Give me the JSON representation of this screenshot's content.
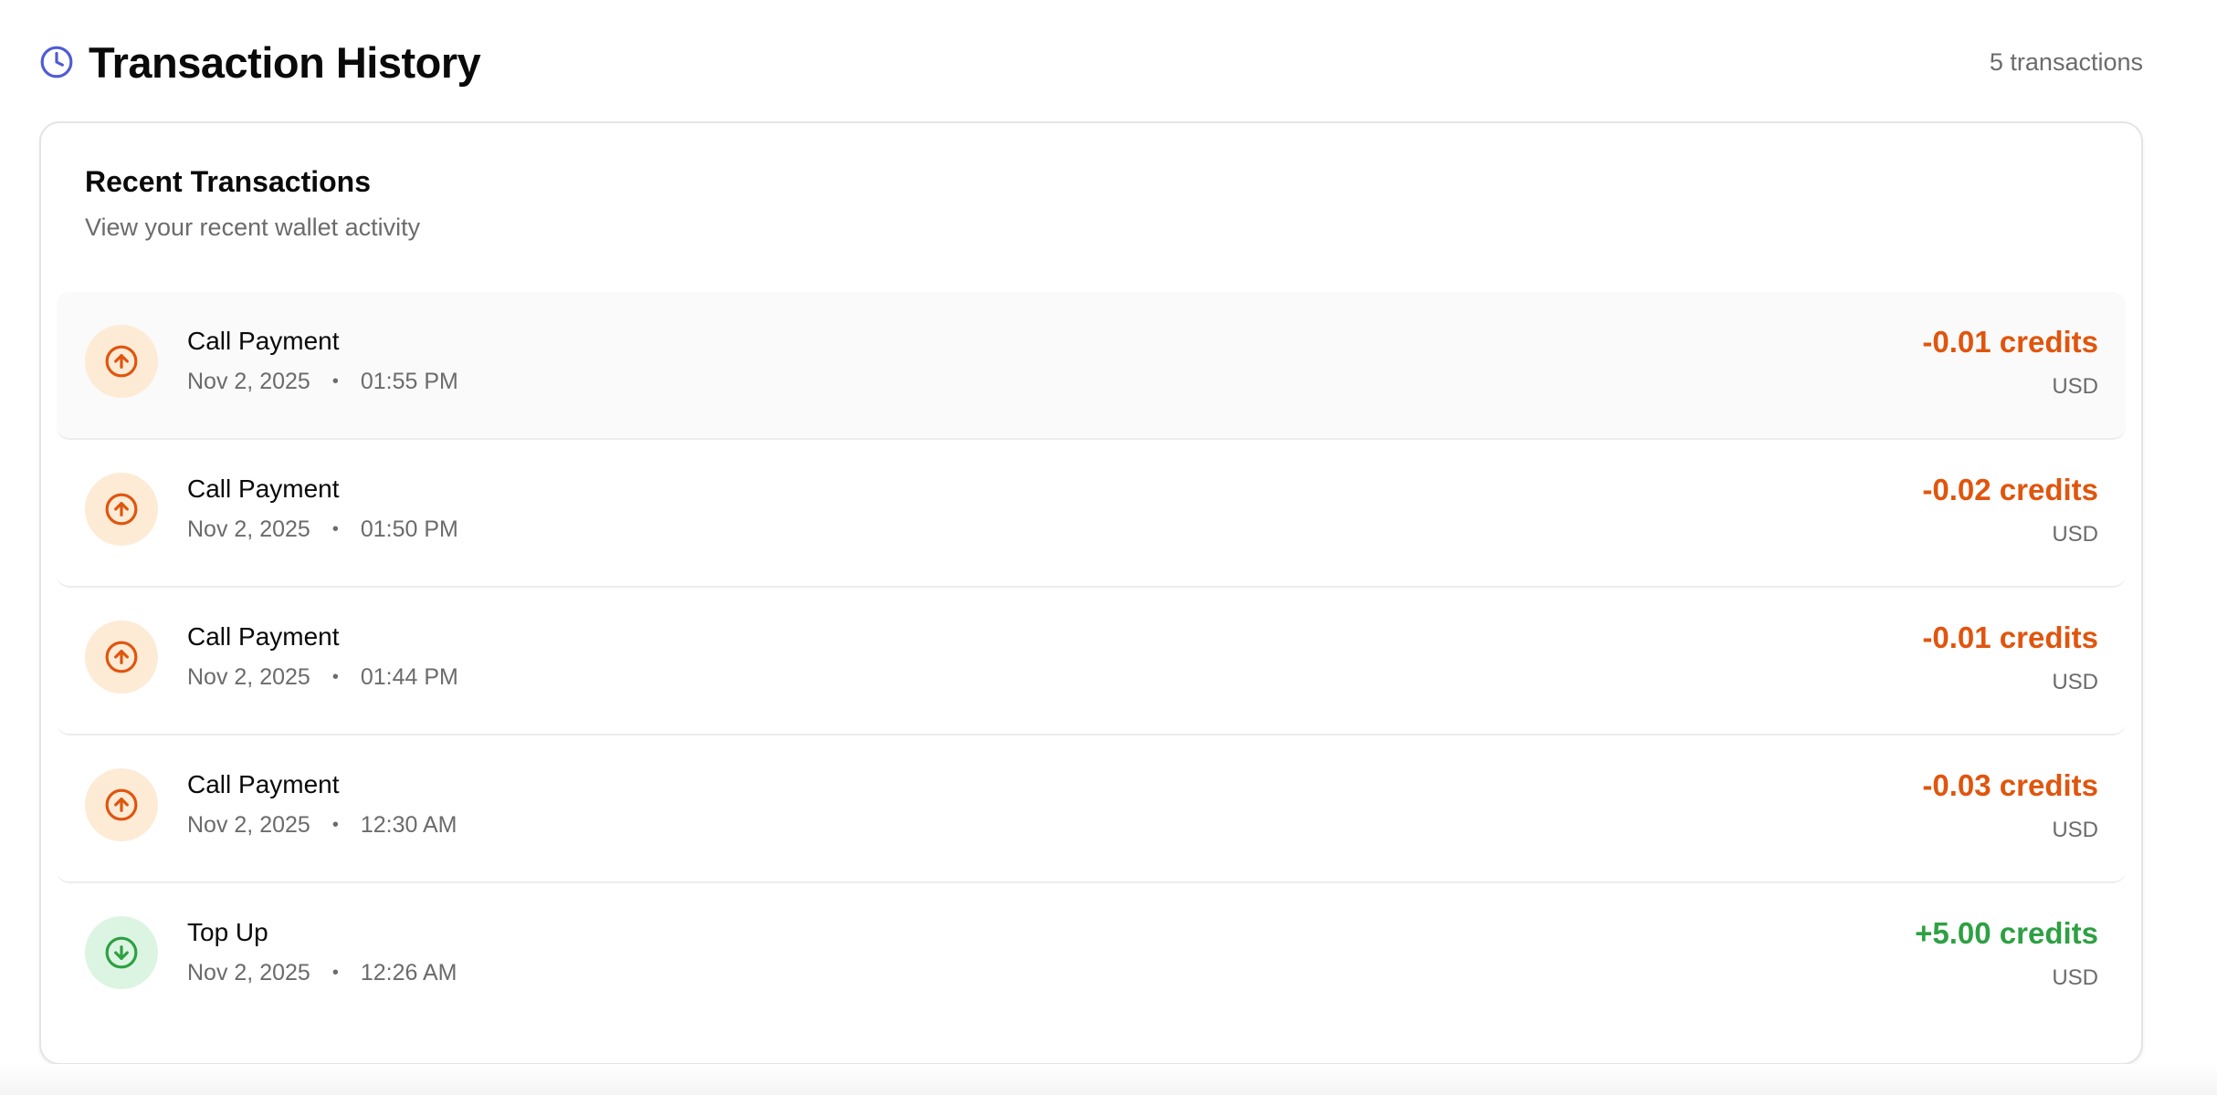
{
  "header": {
    "title": "Transaction History",
    "count_label": "5 transactions",
    "icon": "clock-icon",
    "accent_color": "#4f5bd5"
  },
  "card": {
    "title": "Recent Transactions",
    "subtitle": "View your recent wallet activity"
  },
  "transactions": [
    {
      "name": "Call Payment",
      "date": "Nov 2, 2025",
      "time": "01:55 PM",
      "amount": "-0.01 credits",
      "currency": "USD",
      "direction": "out",
      "icon": "arrow-up-circle-icon"
    },
    {
      "name": "Call Payment",
      "date": "Nov 2, 2025",
      "time": "01:50 PM",
      "amount": "-0.02 credits",
      "currency": "USD",
      "direction": "out",
      "icon": "arrow-up-circle-icon"
    },
    {
      "name": "Call Payment",
      "date": "Nov 2, 2025",
      "time": "01:44 PM",
      "amount": "-0.01 credits",
      "currency": "USD",
      "direction": "out",
      "icon": "arrow-up-circle-icon"
    },
    {
      "name": "Call Payment",
      "date": "Nov 2, 2025",
      "time": "12:30 AM",
      "amount": "-0.03 credits",
      "currency": "USD",
      "direction": "out",
      "icon": "arrow-up-circle-icon"
    },
    {
      "name": "Top Up",
      "date": "Nov 2, 2025",
      "time": "12:26 AM",
      "amount": "+5.00 credits",
      "currency": "USD",
      "direction": "in",
      "icon": "arrow-down-circle-icon"
    }
  ],
  "separator": "•",
  "colors": {
    "debit": "#e0550d",
    "credit": "#2ea043",
    "muted_text": "#6b6b6b"
  }
}
